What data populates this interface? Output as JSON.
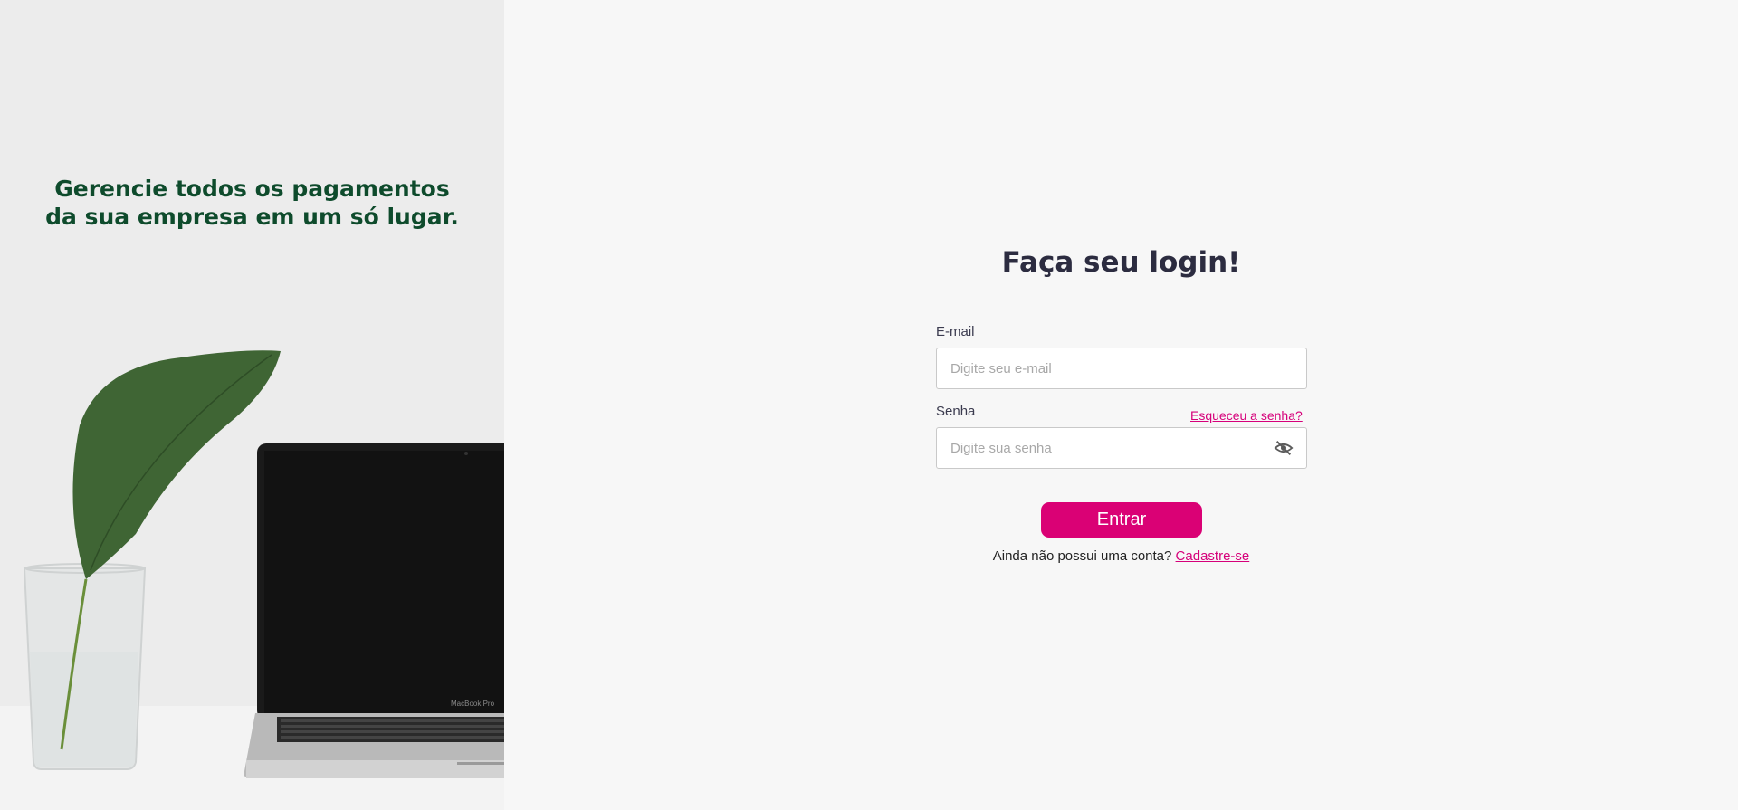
{
  "hero": {
    "headline_line1": "Gerencie todos os pagamentos",
    "headline_line2": "da sua empresa em um só lugar.",
    "laptop_brand": "MacBook Pro"
  },
  "login": {
    "heading": "Faça seu login!",
    "email": {
      "label": "E-mail",
      "placeholder": "Digite seu e-mail",
      "value": ""
    },
    "password": {
      "label": "Senha",
      "placeholder": "Digite sua senha",
      "value": "",
      "toggle_icon": "eye-off-icon"
    },
    "forgot_password_label": "Esqueceu a senha?",
    "submit_label": "Entrar",
    "signup_prompt": "Ainda não possui uma conta?",
    "signup_link": "Cadastre-se"
  },
  "colors": {
    "accent": "#da0175",
    "hero_text": "#0e4b2c",
    "heading": "#2c2c40",
    "background": "#f7f7f7"
  }
}
